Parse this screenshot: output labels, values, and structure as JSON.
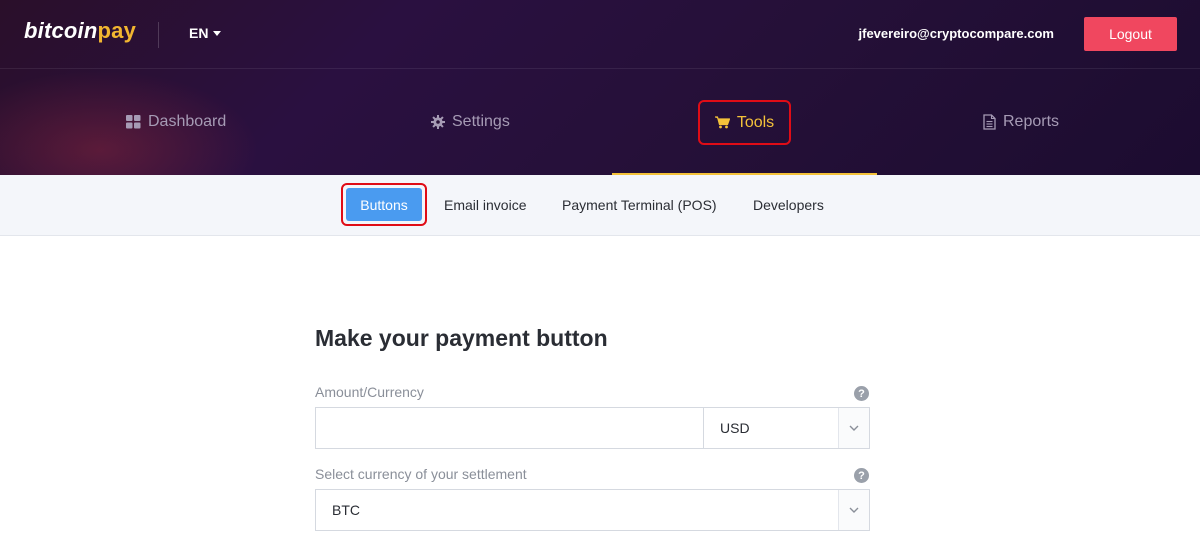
{
  "header": {
    "logo_main": "bitcoin",
    "logo_accent": "pay",
    "language": "EN",
    "user_email": "jfevereiro@cryptocompare.com",
    "logout_label": "Logout"
  },
  "main_nav": {
    "items": [
      {
        "label": "Dashboard",
        "icon": "grid-icon"
      },
      {
        "label": "Settings",
        "icon": "gear-icon"
      },
      {
        "label": "Tools",
        "icon": "cart-icon",
        "active": true
      },
      {
        "label": "Reports",
        "icon": "document-icon"
      }
    ]
  },
  "sub_nav": {
    "items": [
      {
        "label": "Buttons",
        "active": true
      },
      {
        "label": "Email invoice"
      },
      {
        "label": "Payment Terminal (POS)"
      },
      {
        "label": "Developers"
      }
    ]
  },
  "form": {
    "title": "Make your payment button",
    "amount_label": "Amount/Currency",
    "amount_value": "",
    "currency_selected": "USD",
    "settlement_label": "Select currency of your settlement",
    "settlement_selected": "BTC",
    "help_glyph": "?"
  },
  "colors": {
    "accent_yellow": "#f4c23a",
    "logout_red": "#f0475f",
    "active_blue": "#4a9bf0",
    "highlight_red": "#e00c16"
  }
}
